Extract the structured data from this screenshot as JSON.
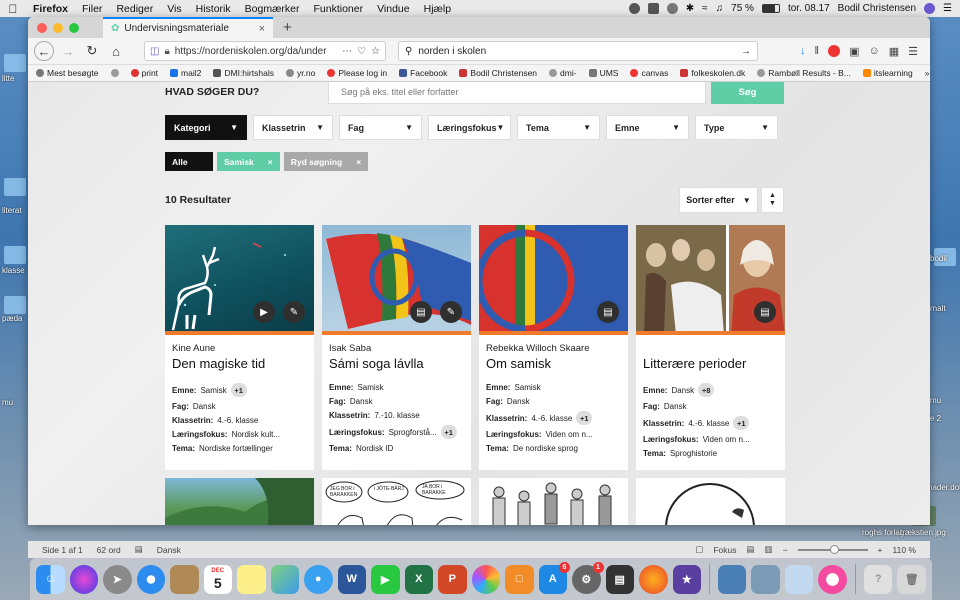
{
  "menubar": {
    "app": "Firefox",
    "items": [
      "Filer",
      "Rediger",
      "Vis",
      "Historik",
      "Bogmærker",
      "Funktioner",
      "Vindue",
      "Hjælp"
    ],
    "battery": "75 %",
    "clock": "tor. 08.17",
    "user": "Bodil Christensen"
  },
  "browser": {
    "tab_title": "Undervisningsmateriale",
    "url": "https://nordeniskolen.org/da/under",
    "search_query": "norden i skolen"
  },
  "bookmarks": [
    "Mest besøgte",
    "print",
    "mail2",
    "DMI:hirtshals",
    "yr.no",
    "Please log in",
    "Facebook",
    "Bodil Christensen",
    "dmi-",
    "UMS",
    "canvas",
    "folkeskolen.dk",
    "Rambøll Results - B...",
    "itslearning"
  ],
  "page": {
    "search_heading": "HVAD SØGER DU?",
    "search_placeholder": "Søg på eks. titel eller forfatter",
    "search_button": "Søg",
    "filters": [
      "Kategori",
      "Klassetrin",
      "Fag",
      "Læringsfokus",
      "Tema",
      "Emne",
      "Type"
    ],
    "chips": {
      "all": "Alle",
      "samisk": "Samisk",
      "clear": "Ryd søgning"
    },
    "results_count": "10 Resultater",
    "sort_label": "Sorter efter",
    "labels": {
      "emne": "Emne:",
      "fag": "Fag:",
      "klassetrin": "Klassetrin:",
      "laeringsfokus": "Læringsfokus:",
      "tema": "Tema:"
    },
    "cards": [
      {
        "author": "Kine Aune",
        "title": "Den magiske tid",
        "emne": "Samisk",
        "emne_more": "+1",
        "fag": "Dansk",
        "klassetrin": "4.-6. klasse",
        "klassetrin_more": "",
        "laeringsfokus": "Nordisk kult...",
        "laeringsfokus_more": "",
        "tema": "Nordiske fortællinger"
      },
      {
        "author": "Isak Saba",
        "title": "Sámi soga lávlla",
        "emne": "Samisk",
        "emne_more": "",
        "fag": "Dansk",
        "klassetrin": "7.-10. klasse",
        "klassetrin_more": "",
        "laeringsfokus": "Sprogforstå...",
        "laeringsfokus_more": "+1",
        "tema": "Nordisk ID"
      },
      {
        "author": "Rebekka Willoch Skaare",
        "title": "Om samisk",
        "emne": "Samisk",
        "emne_more": "",
        "fag": "Dansk",
        "klassetrin": "4.-6. klasse",
        "klassetrin_more": "+1",
        "laeringsfokus": "Viden om n...",
        "laeringsfokus_more": "",
        "tema": "De nordiske sprog"
      },
      {
        "author": "",
        "title": "Litterære perioder",
        "emne": "Dansk",
        "emne_more": "+8",
        "fag": "Dansk",
        "klassetrin": "4.-6. klasse",
        "klassetrin_more": "+1",
        "laeringsfokus": "Viden om n...",
        "laeringsfokus_more": "",
        "tema": "Sproghistorie"
      }
    ],
    "comic_texts": [
      "JEG BOR i BARAKKEN",
      "i JÖTE-BÄRJ",
      "JA BOR i BARAKKE"
    ]
  },
  "statusbar": {
    "page": "Side 1 af 1",
    "words": "62 ord",
    "language": "Dansk",
    "focus": "Fokus",
    "zoom": "110 %"
  },
  "desktop_labels": [
    "litte",
    "klasse",
    "pæda",
    "mu",
    "literat",
    "bodil",
    "rnalt",
    "mu",
    "e 2",
    "hader.dot",
    "roghs forlag",
    "trækstien.jpg"
  ],
  "dock": {
    "calendar_month": "DEC",
    "calendar_day": "5",
    "appstore_badge": "6",
    "settings_badge": "1"
  }
}
